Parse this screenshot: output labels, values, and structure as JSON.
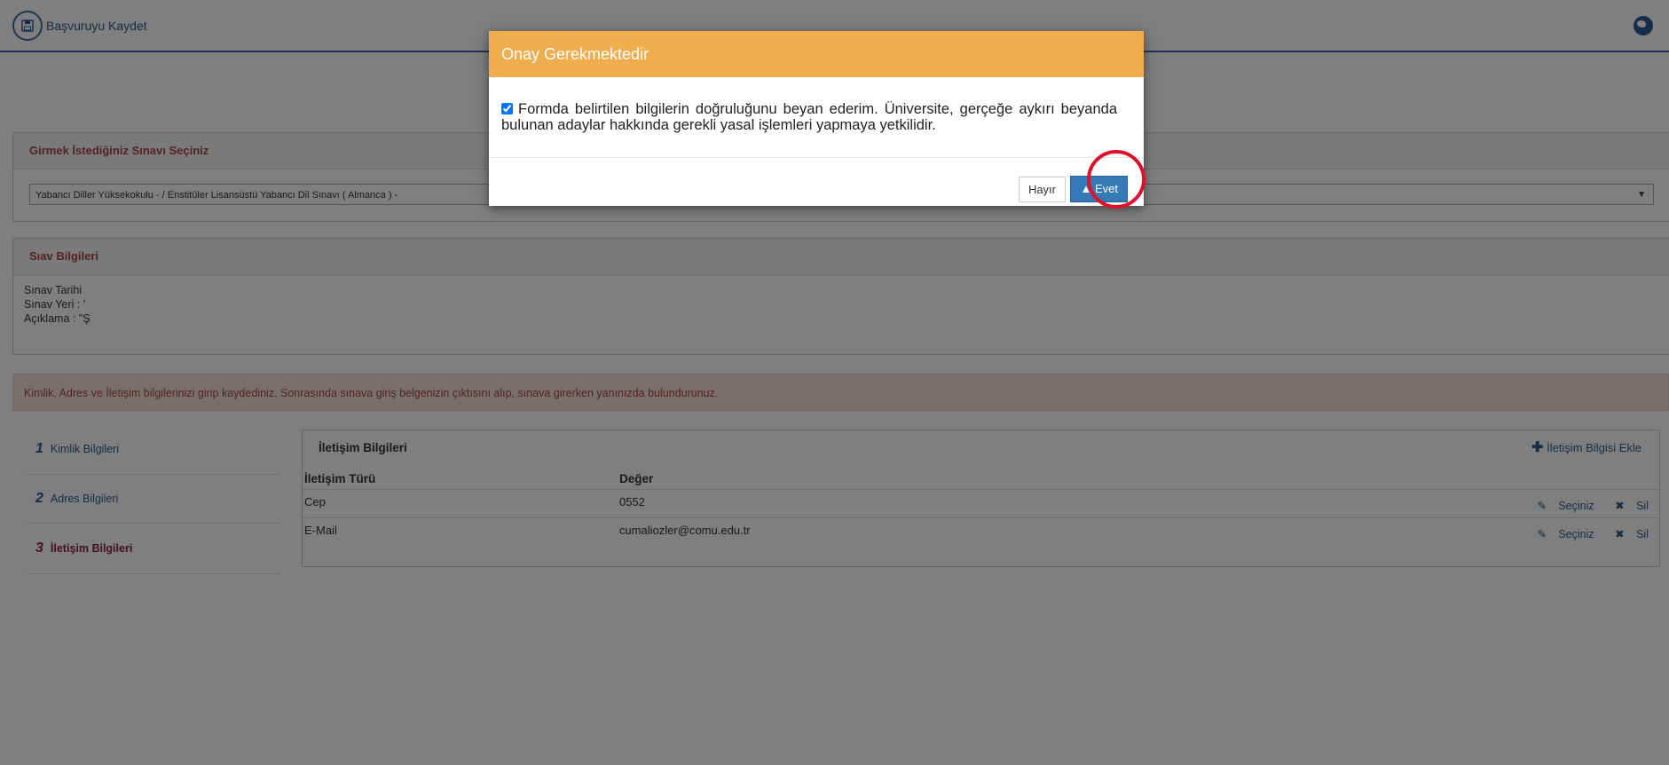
{
  "header": {
    "save_label": "Başvuruyu Kaydet"
  },
  "exam_select": {
    "title": "Girmek İstediğiniz Sınavı Seçiniz",
    "selected": "Yabancı Diller Yüksekokulu - / Enstitüler Lisansüstü Yabancı Dil Sınavı ( Almanca ) - "
  },
  "exam_info": {
    "title": "Sıav Bilgileri",
    "date_label": "Sınav Tarihi",
    "place_label": "Sınav Yeri : '",
    "description_label": "Açıklama : \"Ş"
  },
  "alert": {
    "text": "Kimlik, Adres ve İletişim bilgilerinizi girip kaydediniz. Sonrasında sınava giriş belgenizin çıktısını alıp, sınava girerken yanınızda bulundurunuz."
  },
  "steps": [
    {
      "num": "1",
      "label": "Kimlik Bilgileri"
    },
    {
      "num": "2",
      "label": "Adres Bilgileri"
    },
    {
      "num": "3",
      "label": "İletişim Bilgileri"
    }
  ],
  "contact": {
    "title": "İletişim Bilgileri",
    "add_label": "İletişim Bilgisi Ekle",
    "columns": [
      "İletişim Türü",
      "Değer"
    ],
    "rows": [
      {
        "type": "Cep",
        "value": "0552"
      },
      {
        "type": "E-Mail",
        "value": "cumaliozler@comu.edu.tr"
      }
    ],
    "select_label": "Seçiniz",
    "delete_label": "Sil"
  },
  "modal": {
    "title": "Onay Gerekmektedir",
    "body": "Formda belirtilen bilgilerin doğruluğunu beyan ederim. Üniversite, gerçeğe aykırı beyanda bulunan adaylar hakkında gerekli yasal işlemleri yapmaya yetkilidir.",
    "checked": true,
    "no_label": "Hayır",
    "yes_label": "Evet"
  },
  "colors": {
    "accent": "#337ab7",
    "modal_header": "#f0ad4e",
    "alert_bg": "#f2dede",
    "annotation": "#e0102a"
  }
}
